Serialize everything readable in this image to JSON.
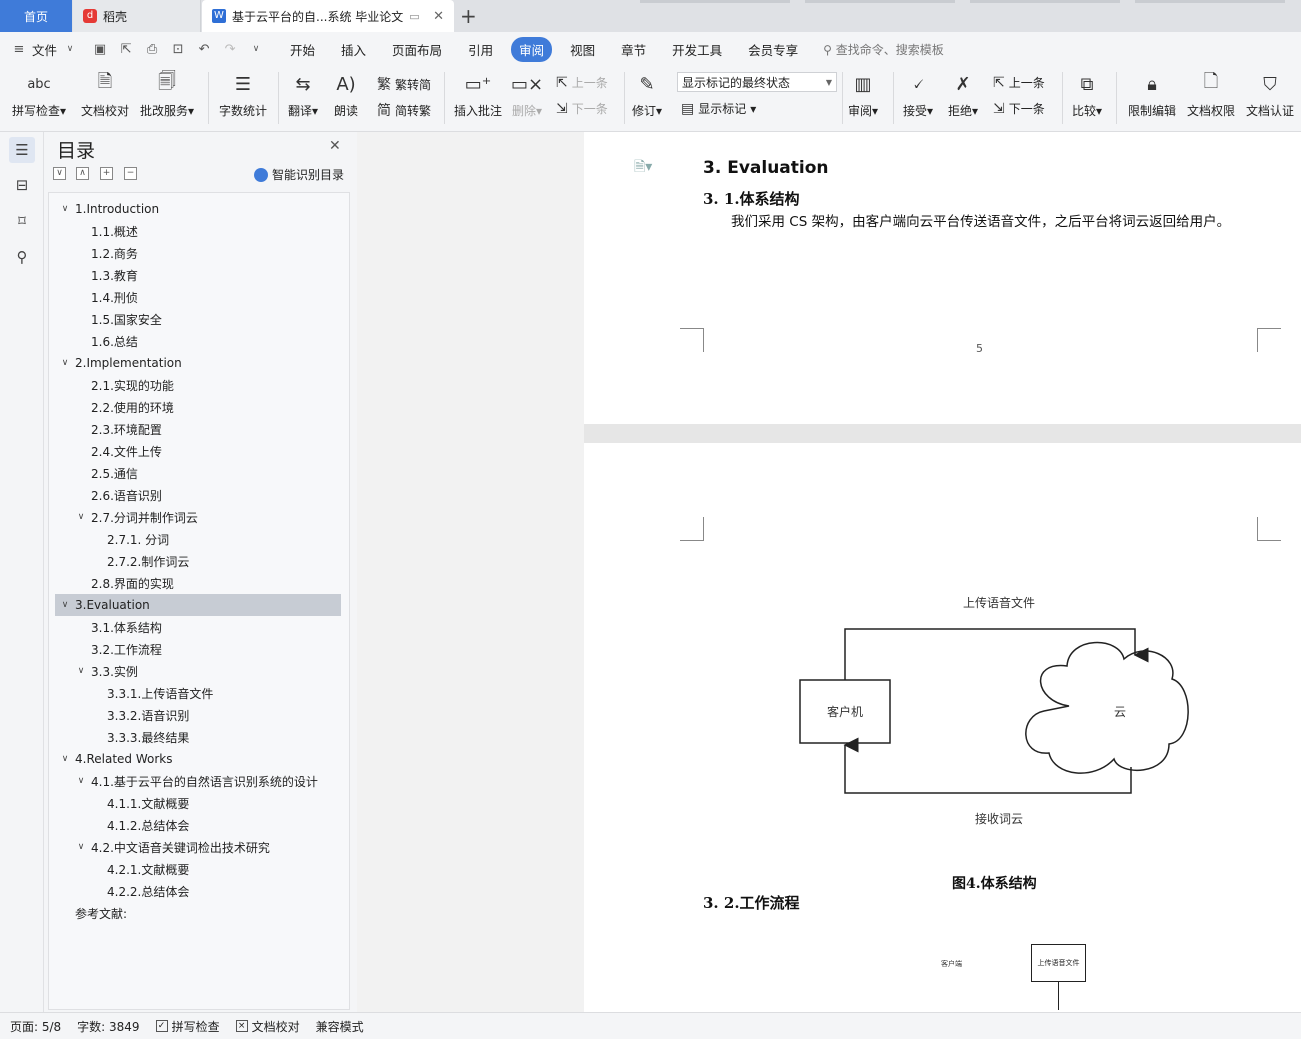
{
  "tabs": {
    "home": "首页",
    "daoke": "稻壳",
    "doc": "基于云平台的自...系统 毕业论文"
  },
  "menu": {
    "file": "文件",
    "items": [
      "开始",
      "插入",
      "页面布局",
      "引用",
      "审阅",
      "视图",
      "章节",
      "开发工具",
      "会员专享"
    ],
    "active": "审阅",
    "search": "查找命令、搜索模板"
  },
  "ribbon": {
    "spellcheck": "拼写检查",
    "doccheck": "文档校对",
    "revise_service": "批改服务",
    "wordcount": "字数统计",
    "translate": "翻译",
    "read_aloud": "朗读",
    "trad": "繁转简",
    "simp": "简转繁",
    "insert_comment": "插入批注",
    "delete": "删除",
    "prev_comment": "上一条",
    "next_comment": "下一条",
    "track": "修订",
    "markup_state": "显示标记的最终状态",
    "show_markup": "显示标记",
    "review": "审阅",
    "accept": "接受",
    "reject": "拒绝",
    "prev_change": "上一条",
    "next_change": "下一条",
    "compare": "比较",
    "restrict": "限制编辑",
    "permission": "文档权限",
    "certify": "文档认证"
  },
  "toc": {
    "title": "目录",
    "smart": "智能识别目录",
    "items": [
      {
        "text": "1.Introduction",
        "level": 1,
        "toggle": "∨"
      },
      {
        "text": "1.1.概述",
        "level": 2
      },
      {
        "text": "1.2.商务",
        "level": 2
      },
      {
        "text": "1.3.教育",
        "level": 2
      },
      {
        "text": "1.4.刑侦",
        "level": 2
      },
      {
        "text": "1.5.国家安全",
        "level": 2
      },
      {
        "text": "1.6.总结",
        "level": 2
      },
      {
        "text": "2.Implementation",
        "level": 1,
        "toggle": "∨"
      },
      {
        "text": "2.1.实现的功能",
        "level": 2
      },
      {
        "text": "2.2.使用的环境",
        "level": 2
      },
      {
        "text": "2.3.环境配置",
        "level": 2
      },
      {
        "text": "2.4.文件上传",
        "level": 2
      },
      {
        "text": "2.5.通信",
        "level": 2
      },
      {
        "text": "2.6.语音识别",
        "level": 2
      },
      {
        "text": "2.7.分词并制作词云",
        "level": 2,
        "toggle": "∨"
      },
      {
        "text": "2.7.1. 分词",
        "level": 3
      },
      {
        "text": "2.7.2.制作词云",
        "level": 3
      },
      {
        "text": "2.8.界面的实现",
        "level": 2
      },
      {
        "text": "3.Evaluation",
        "level": 1,
        "toggle": "∨",
        "selected": true
      },
      {
        "text": "3.1.体系结构",
        "level": 2
      },
      {
        "text": "3.2.工作流程",
        "level": 2
      },
      {
        "text": "3.3.实例",
        "level": 2,
        "toggle": "∨"
      },
      {
        "text": "3.3.1.上传语音文件",
        "level": 3
      },
      {
        "text": "3.3.2.语音识别",
        "level": 3
      },
      {
        "text": "3.3.3.最终结果",
        "level": 3
      },
      {
        "text": "4.Related Works",
        "level": 1,
        "toggle": "∨"
      },
      {
        "text": "4.1.基于云平台的自然语言识别系统的设计",
        "level": 2,
        "toggle": "∨"
      },
      {
        "text": "4.1.1.文献概要",
        "level": 3
      },
      {
        "text": "4.1.2.总结体会",
        "level": 3
      },
      {
        "text": "4.2.中文语音关键词检出技术研究",
        "level": 2,
        "toggle": "∨"
      },
      {
        "text": "4.2.1.文献概要",
        "level": 3
      },
      {
        "text": "4.2.2.总结体会",
        "level": 3
      },
      {
        "text": "参考文献:",
        "level": 1
      }
    ]
  },
  "document": {
    "heading": "3. Evaluation",
    "sub1": "3. 1.体系结构",
    "para1": "我们采用 CS 架构，由客户端向云平台传送语音文件，之后平台将词云返回给用户。",
    "page_number": "5",
    "diagram": {
      "upload_label": "上传语音文件",
      "client": "客户机",
      "cloud": "云",
      "receive_label": "接收词云"
    },
    "caption": "图4.体系结构",
    "sub2": "3. 2.工作流程",
    "flow": {
      "client": "客户端",
      "upload_box": "上传语音文件"
    }
  },
  "status": {
    "page": "页面: 5/8",
    "words": "字数: 3849",
    "spell": "拼写检查",
    "proof": "文档校对",
    "compat": "兼容模式"
  }
}
